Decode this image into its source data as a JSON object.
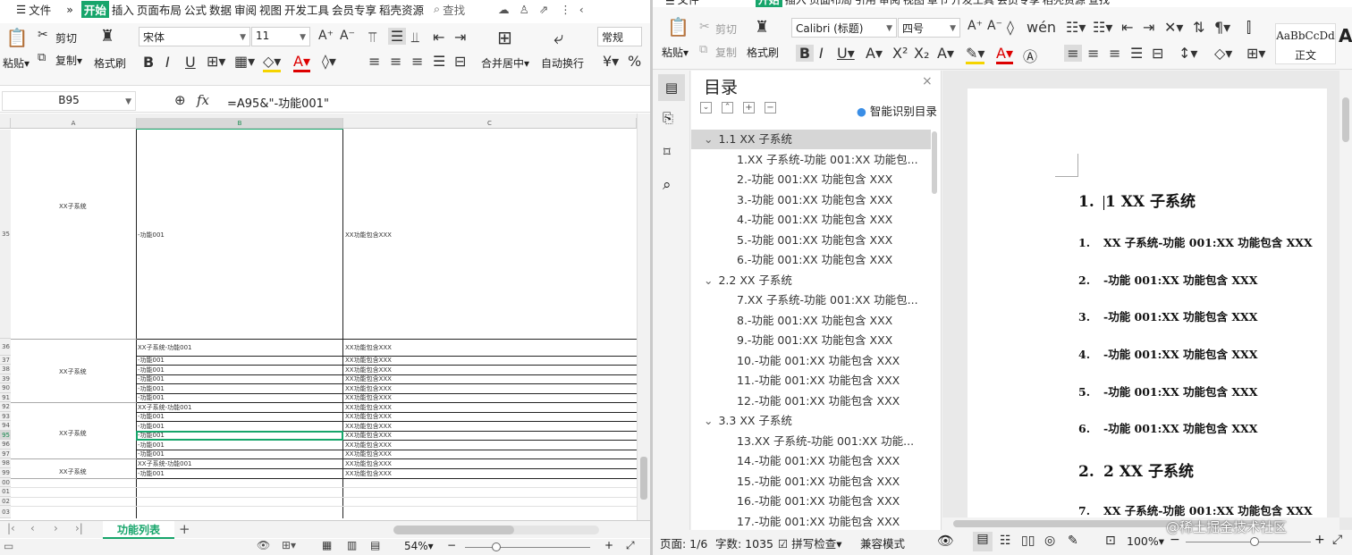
{
  "sheet": {
    "menu": [
      "文件",
      "»",
      "开始",
      "插入",
      "页面布局",
      "公式",
      "数据",
      "审阅",
      "视图",
      "开发工具",
      "会员专享",
      "稻壳资源",
      "查找"
    ],
    "ribbon": {
      "paste": "粘贴",
      "cut": "剪切",
      "copy": "复制",
      "format_painter": "格式刷",
      "font_name": "宋体",
      "font_size": "11",
      "merge_center": "合并居中",
      "wrap_text": "自动换行",
      "number_format": "常规"
    },
    "formula_bar": {
      "cell_ref": "B95",
      "fx": "fx",
      "formula": "=A95&\"-功能001\""
    },
    "columns": [
      "A",
      "B",
      "C"
    ],
    "row_numbers": [
      "35",
      "36",
      "37",
      "38",
      "39",
      "90",
      "91",
      "92",
      "93",
      "94",
      "95",
      "96",
      "97",
      "98",
      "99",
      "00",
      "01",
      "02",
      "03"
    ],
    "cells": {
      "a_group1": "XX子系统",
      "a_group2": "XX子系统",
      "a_group3": "XX子系统",
      "a_group4": "XX子系统",
      "b_r35": "-功能001",
      "c_r35": "XX功能包含XXX",
      "b_rows": [
        "XX子系统-功能001",
        "-功能001",
        "-功能001",
        "-功能001",
        "-功能001",
        "-功能001",
        "XX子系统-功能001",
        "-功能001",
        "-功能001",
        "-功能001",
        "-功能001",
        "-功能001",
        "XX子系统-功能001",
        "-功能001"
      ],
      "c_rows": [
        "XX功能包含XXX",
        "XX功能包含XXX",
        "XX功能包含XXX",
        "XX功能包含XXX",
        "XX功能包含XXX",
        "XX功能包含XXX",
        "XX功能包含XXX",
        "XX功能包含XXX",
        "XX功能包含XXX",
        "XX功能包含XXX",
        "XX功能包含XXX",
        "XX功能包含XXX",
        "XX功能包含XXX",
        "XX功能包含XXX"
      ]
    },
    "sheet_tab": "功能列表",
    "add_sheet": "+",
    "zoom": "54%"
  },
  "writer": {
    "menu": [
      "文件",
      "开始",
      "插入",
      "页面布局",
      "引用",
      "审阅",
      "视图",
      "章节",
      "开发工具",
      "会员专享",
      "稻壳资源",
      "查找"
    ],
    "ribbon": {
      "paste": "粘贴",
      "cut": "剪切",
      "copy": "复制",
      "format_painter": "格式刷",
      "font_name": "Calibri (标题)",
      "font_size": "四号",
      "style_preview": "AaBbCcDd",
      "style_name": "正文"
    },
    "toc": {
      "title": "目录",
      "smart_detect": "智能识别目录",
      "items": [
        {
          "text": "1.1 XX 子系统",
          "level": 1,
          "selected": true
        },
        {
          "text": "1.XX 子系统-功能 001:XX 功能包...",
          "level": 2
        },
        {
          "text": "2.-功能 001:XX 功能包含 XXX",
          "level": 2
        },
        {
          "text": "3.-功能 001:XX 功能包含 XXX",
          "level": 2
        },
        {
          "text": "4.-功能 001:XX 功能包含 XXX",
          "level": 2
        },
        {
          "text": "5.-功能 001:XX 功能包含 XXX",
          "level": 2
        },
        {
          "text": "6.-功能 001:XX 功能包含 XXX",
          "level": 2
        },
        {
          "text": "2.2 XX 子系统",
          "level": 1
        },
        {
          "text": "7.XX 子系统-功能 001:XX 功能包...",
          "level": 2
        },
        {
          "text": "8.-功能 001:XX 功能包含 XXX",
          "level": 2
        },
        {
          "text": "9.-功能 001:XX 功能包含 XXX",
          "level": 2
        },
        {
          "text": "10.-功能 001:XX 功能包含 XXX",
          "level": 2
        },
        {
          "text": "11.-功能 001:XX 功能包含 XXX",
          "level": 2
        },
        {
          "text": "12.-功能 001:XX 功能包含 XXX",
          "level": 2
        },
        {
          "text": "3.3 XX 子系统",
          "level": 1
        },
        {
          "text": "13.XX 子系统-功能 001:XX 功能...",
          "level": 2
        },
        {
          "text": "14.-功能 001:XX 功能包含 XXX",
          "level": 2
        },
        {
          "text": "15.-功能 001:XX 功能包含 XXX",
          "level": 2
        },
        {
          "text": "16.-功能 001:XX 功能包含 XXX",
          "level": 2
        },
        {
          "text": "17.-功能 001:XX 功能包含 XXX",
          "level": 2
        }
      ]
    },
    "document": {
      "lines": [
        {
          "num": "1.",
          "text": "1 XX 子系统",
          "kind": "h1"
        },
        {
          "num": "1.",
          "text": "XX 子系统-功能 001:XX 功能包含 XXX",
          "kind": "h2"
        },
        {
          "num": "2.",
          "text": "-功能 001:XX 功能包含 XXX",
          "kind": "h2"
        },
        {
          "num": "3.",
          "text": "-功能 001:XX 功能包含 XXX",
          "kind": "h2"
        },
        {
          "num": "4.",
          "text": "-功能 001:XX 功能包含 XXX",
          "kind": "h2"
        },
        {
          "num": "5.",
          "text": "-功能 001:XX 功能包含 XXX",
          "kind": "h2"
        },
        {
          "num": "6.",
          "text": "-功能 001:XX 功能包含 XXX",
          "kind": "h2"
        },
        {
          "num": "2.",
          "text": "2 XX 子系统",
          "kind": "h1"
        },
        {
          "num": "7.",
          "text": "XX 子系统-功能 001:XX 功能包含 XXX",
          "kind": "h2"
        }
      ]
    },
    "status": {
      "page": "页面: 1/6",
      "words": "字数: 1035",
      "spell": "拼写检查",
      "compat": "兼容模式",
      "zoom": "100%",
      "watermark": "@稀土掘金技术社区"
    }
  }
}
